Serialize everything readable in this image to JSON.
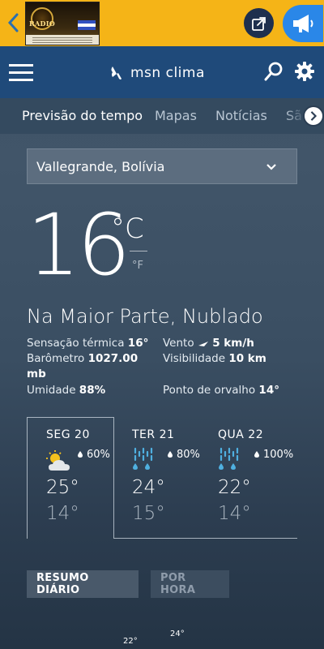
{
  "topbar": {
    "back_icon": "chevron-left-icon",
    "ad_text": "RADIO",
    "share_icon": "share-icon",
    "speaker_icon": "megaphone-icon",
    "bg_color": "#f5b417"
  },
  "appbar": {
    "menu_icon": "hamburger-icon",
    "brand": "msn  clima",
    "search_icon": "search-icon",
    "settings_icon": "gear-icon",
    "bg_color": "#1f4a7a"
  },
  "tabs": [
    {
      "label": "Previsão do tempo",
      "active": true
    },
    {
      "label": "Mapas",
      "active": false
    },
    {
      "label": "Notícias",
      "active": false
    },
    {
      "label": "Sã",
      "active": false
    }
  ],
  "location": {
    "value": "Vallegrande, Bolívia"
  },
  "current": {
    "temperature": "16",
    "unit_primary": "°C",
    "unit_secondary": "°F",
    "condition": "Na Maior Parte, Nublado"
  },
  "details": {
    "feels_like_label": "Sensação térmica",
    "feels_like_value": "16°",
    "wind_label": "Vento",
    "wind_value": "5 km/h",
    "barometer_label": "Barômetro",
    "barometer_value": "1027.00",
    "barometer_unit": "mb",
    "visibility_label": "Visibilidade",
    "visibility_value": "10 km",
    "humidity_label": "Umidade",
    "humidity_value": "88%",
    "dewpoint_label": "Ponto de orvalho",
    "dewpoint_value": "14°"
  },
  "forecast": [
    {
      "day": "SEG 20",
      "precip": "60%",
      "high": "25°",
      "low": "14°",
      "icon": "partly-cloudy-sun-icon",
      "selected": true
    },
    {
      "day": "TER 21",
      "precip": "80%",
      "high": "24°",
      "low": "15°",
      "icon": "rain-icon",
      "selected": false
    },
    {
      "day": "QUA 22",
      "precip": "100%",
      "high": "22°",
      "low": "14°",
      "icon": "rain-icon",
      "selected": false
    }
  ],
  "buttons": {
    "summary": "RESUMO DIÁRIO",
    "hourly": "POR HORA"
  },
  "peek": {
    "left": "22°",
    "right": "24°"
  }
}
